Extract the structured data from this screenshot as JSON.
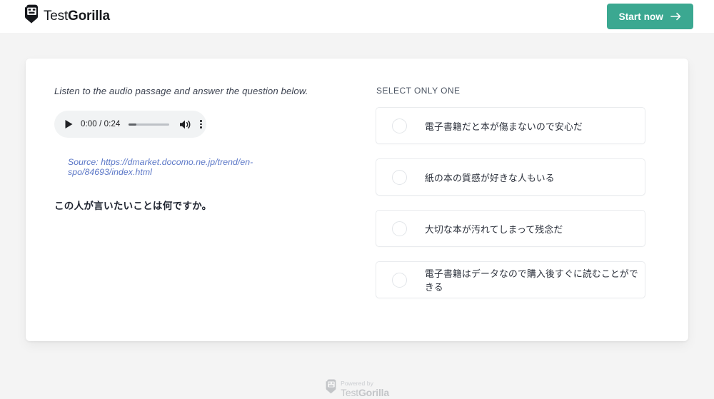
{
  "header": {
    "brand": {
      "icon": "gorilla-logo-icon",
      "name_light": "Test",
      "name_bold": "Gorilla"
    },
    "start_button": {
      "label": "Start now",
      "icon": "arrow-right-icon",
      "color": "#3ba891"
    }
  },
  "main": {
    "left": {
      "instruction": "Listen to the audio passage and answer the question below.",
      "audio_player": {
        "play_icon": "play-icon",
        "time": "0:00 / 0:24",
        "current_time": "0:00",
        "duration": "0:24",
        "progress_percent": 0,
        "volume_icon": "volume-icon",
        "menu_icon": "more-vertical-icon"
      },
      "source": {
        "prefix": "Source: ",
        "url": "https://dmarket.docomo.ne.jp/trend/en-spo/84693/index.html",
        "full_text": "Source: https://dmarket.docomo.ne.jp/trend/en-spo/84693/index.html",
        "color": "#5b77c7"
      },
      "question": "この人が言いたいことは何ですか。"
    },
    "right": {
      "select_label": "SELECT ONLY ONE",
      "options": [
        {
          "label": "電子書籍だと本が傷まないので安心だ",
          "selected": false
        },
        {
          "label": "紙の本の質感が好きな人もいる",
          "selected": false
        },
        {
          "label": "大切な本が汚れてしまって残念だ",
          "selected": false
        },
        {
          "label": "電子書籍はデータなので購入後すぐに読むことができる",
          "selected": false
        }
      ]
    }
  },
  "footer": {
    "powered_by": "Powered by",
    "brand_light": "Test",
    "brand_bold": "Gorilla",
    "icon": "gorilla-logo-icon"
  }
}
